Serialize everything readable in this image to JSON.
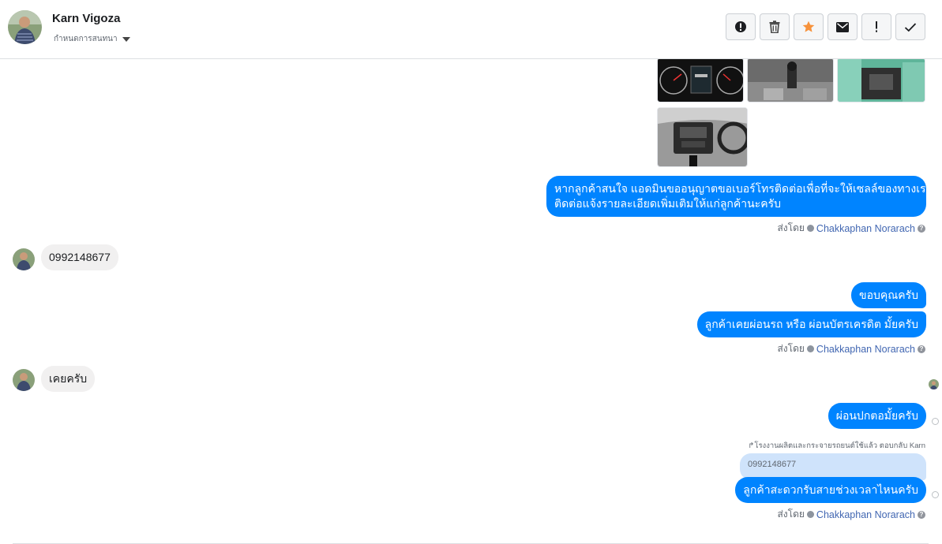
{
  "header": {
    "contact_name": "Karn Vigoza",
    "label_select": "กำหนดการสนทนา",
    "actions": [
      {
        "name": "report-button",
        "icon": "alert-circle-icon"
      },
      {
        "name": "delete-button",
        "icon": "trash-icon"
      },
      {
        "name": "star-button",
        "icon": "star-icon"
      },
      {
        "name": "mark-unread-button",
        "icon": "envelope-icon"
      },
      {
        "name": "important-button",
        "icon": "exclamation-icon"
      },
      {
        "name": "done-button",
        "icon": "checkmark-icon"
      }
    ]
  },
  "colors": {
    "outgoing_bubble": "#0084ff",
    "incoming_bubble": "#f1f0f0",
    "star": "#f7923b",
    "agent_link": "#4267b2"
  },
  "messages": {
    "m1": "หากลูกค้าสนใจ แอดมินขออนุญาตขอเบอร์โทรติดต่อเพื่อที่จะให้เซลล์ของทางเรา",
    "m1b": "ติดต่อแจ้งรายละเอียดเพิ่มเติมให้แก่ลูกค้านะครับ",
    "in1": "0992148677",
    "m2": "ขอบคุณครับ",
    "m3": "ลูกค้าเคยผ่อนรถ หรือ ผ่อนบัตรเครดิต มั้ยครับ",
    "in2": "เคยครับ",
    "m4": "ผ่อนปกตอมั้ยครับ",
    "reply_note": "โรงงานผลิตและกระจายรถยนต์ใช้แล้ว ตอบกลับ Karn",
    "quoted": "0992148677",
    "m5": "ลูกค้าสะดวกรับสายช่วงเวลาไหนครับ"
  },
  "sent_by": {
    "prefix": "ส่งโดย",
    "agent": "Chakkaphan Norarach",
    "help": "?"
  }
}
